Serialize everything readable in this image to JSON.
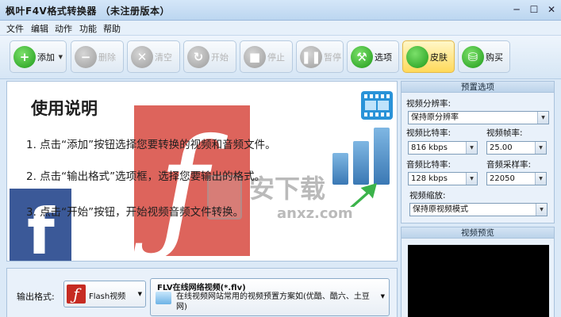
{
  "window": {
    "title": "枫叶F4V格式转换器  （未注册版本）",
    "minimize": "─",
    "maximize": "☐",
    "close": "✕"
  },
  "menu": [
    "文件",
    "编辑",
    "动作",
    "功能",
    "帮助"
  ],
  "toolbar": {
    "add": "添加",
    "delete": "删除",
    "clear": "清空",
    "start": "开始",
    "stop": "停止",
    "pause": "暂停",
    "options": "选项",
    "skin": "皮肤",
    "buy": "购买"
  },
  "instructions": {
    "title": "使用说明",
    "step1": "1. 点击“添加”按钮选择您要转换的视频和音频文件。",
    "step2": "2. 点击“输出格式”选项框，选择您要输出的格式。",
    "step3": "3. 点击“开始”按钮，开始视频音频文件转换。",
    "watermark_main": "安下载",
    "watermark_sub": "anxz.com"
  },
  "output": {
    "label": "输出格式:",
    "format": "Flash视频",
    "preset_title": "FLV在线网络视频(*.flv)",
    "preset_desc": "在线视频网站常用的视频预置方案如(优酷、酷六、土豆网)"
  },
  "settings": {
    "header": "预置选项",
    "resolution_label": "视频分辨率:",
    "resolution_value": "保持原分辨率",
    "video_bitrate_label": "视频比特率:",
    "video_bitrate_value": "816 kbps",
    "frame_rate_label": "视频帧率:",
    "frame_rate_value": "25.00",
    "audio_bitrate_label": "音频比特率:",
    "audio_bitrate_value": "128 kbps",
    "sample_rate_label": "音频采样率:",
    "sample_rate_value": "22050",
    "scale_label": "视频缩放:",
    "scale_value": "保持原视频模式"
  },
  "preview": {
    "header": "视频预览"
  }
}
